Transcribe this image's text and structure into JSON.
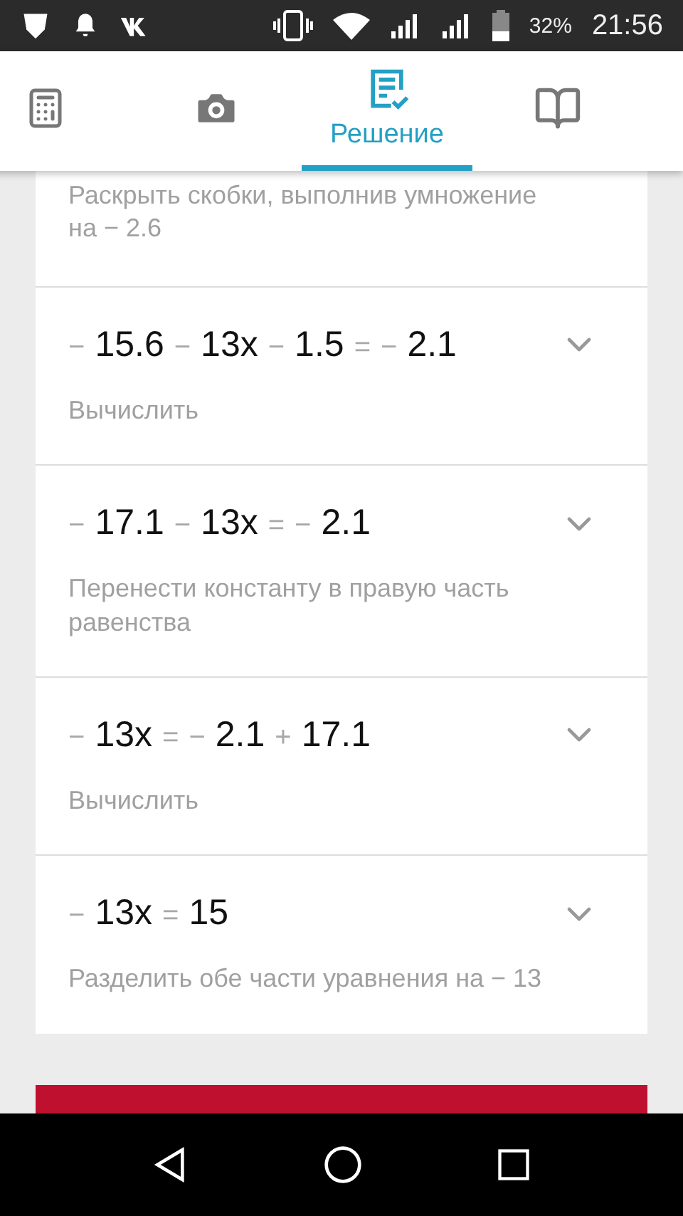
{
  "status_bar": {
    "battery": "32%",
    "time": "21:56"
  },
  "tabs": [
    {
      "selected": false
    },
    {
      "selected": false
    },
    {
      "label": "Решение",
      "selected": true
    },
    {
      "selected": false
    }
  ],
  "first_step_description": "Раскрыть скобки, выполнив умножение на − 2.6",
  "steps": [
    {
      "equation": [
        {
          "text": "−",
          "kind": "op"
        },
        {
          "text": "15.6",
          "kind": "num"
        },
        {
          "text": "−",
          "kind": "op"
        },
        {
          "text": "13x",
          "kind": "num"
        },
        {
          "text": "−",
          "kind": "op"
        },
        {
          "text": "1.5",
          "kind": "num"
        },
        {
          "text": "=",
          "kind": "op"
        },
        {
          "text": "−",
          "kind": "op"
        },
        {
          "text": "2.1",
          "kind": "num"
        }
      ],
      "description": "Вычислить",
      "expanded": false
    },
    {
      "equation": [
        {
          "text": "−",
          "kind": "op"
        },
        {
          "text": "17.1",
          "kind": "num"
        },
        {
          "text": "−",
          "kind": "op"
        },
        {
          "text": "13x",
          "kind": "num"
        },
        {
          "text": "=",
          "kind": "op"
        },
        {
          "text": "−",
          "kind": "op"
        },
        {
          "text": "2.1",
          "kind": "num"
        }
      ],
      "description": "Перенести константу в правую часть равенства",
      "expanded": false
    },
    {
      "equation": [
        {
          "text": "−",
          "kind": "op"
        },
        {
          "text": "13x",
          "kind": "num"
        },
        {
          "text": "=",
          "kind": "op"
        },
        {
          "text": "−",
          "kind": "op"
        },
        {
          "text": "2.1",
          "kind": "num"
        },
        {
          "text": "+",
          "kind": "op"
        },
        {
          "text": "17.1",
          "kind": "num"
        }
      ],
      "description": "Вычислить",
      "expanded": false
    },
    {
      "equation": [
        {
          "text": "−",
          "kind": "op"
        },
        {
          "text": "13x",
          "kind": "num"
        },
        {
          "text": "=",
          "kind": "op"
        },
        {
          "text": "15",
          "kind": "num"
        }
      ],
      "description": "Разделить обе части уравнения на − 13",
      "expanded": false
    }
  ]
}
